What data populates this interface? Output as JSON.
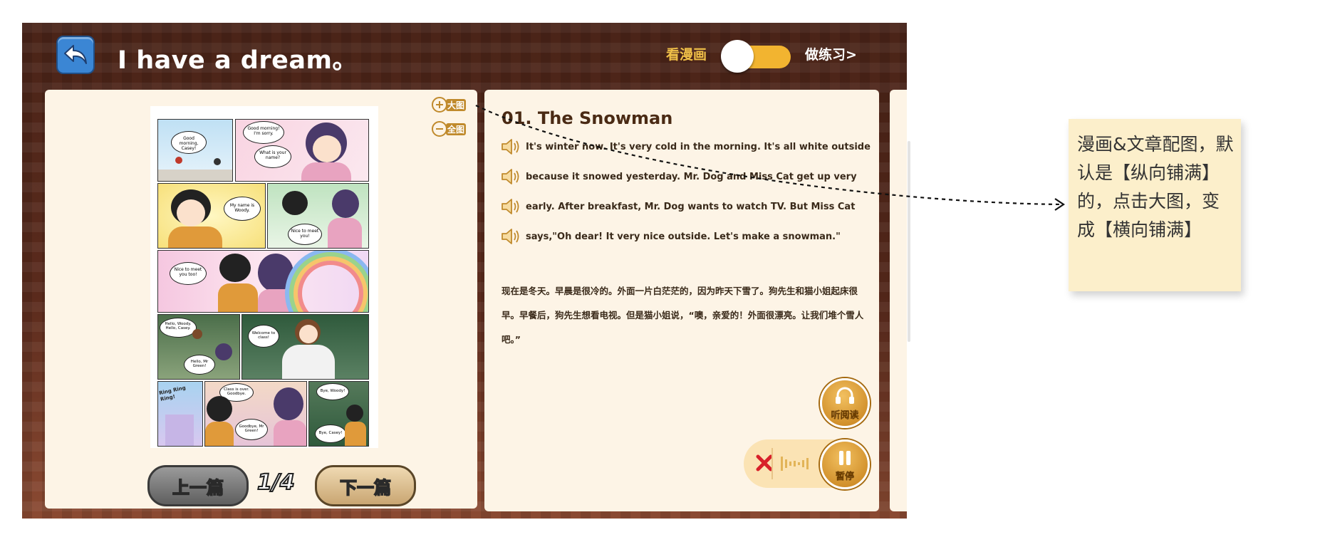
{
  "header": {
    "title": "I have a dream。",
    "mode_comic_label": "看漫画",
    "mode_exercise_label": "做练习>"
  },
  "left_panel": {
    "zoom_in_label": "大图",
    "zoom_out_label": "全图",
    "prev_label": "上一篇",
    "next_label": "下一篇",
    "page_indicator": "1/4",
    "comic_bubbles": {
      "b1": "Good morning, Casey!",
      "b2": "Good morning! I'm sorry.",
      "b3": "What is your name?",
      "b4": "My name is Woody.",
      "b5": "Nice to meet you!",
      "b6": "Nice to meet you too!",
      "b7": "Hello, Woody. Hello, Casey.",
      "b8": "Hello, Mr Green!",
      "b9": "Welcome to class!",
      "b10": "Ring Ring Ring!",
      "b11": "Class is over. Goodbye.",
      "b12": "Goodbye, Mr Green!",
      "b13": "Bye, Woody!",
      "b14": "Bye, Casey!"
    }
  },
  "article": {
    "title": "01. The Snowman",
    "english_lines": [
      "It's winter now. It's very cold in the morning. It's all white outside",
      "because it snowed yesterday. Mr. Dog and Miss Cat get up very",
      "early. After breakfast, Mr. Dog wants to watch TV. But Miss Cat",
      "says,\"Oh dear! It  very nice outside. Let's make a snowman.\""
    ],
    "chinese_text": "现在是冬天。早晨是很冷的。外面一片白茫茫的，因为昨天下雪了。狗先生和猫小姐起床很早。早餐后，狗先生想看电视。但是猫小姐说，“噢，亲爱的！外面很漂亮。让我们堆个雪人吧。”",
    "listen_label": "听阅读",
    "pause_label": "暂停"
  },
  "annotation": {
    "note_text": "漫画&文章配图，默认是【纵向铺满】的，点击大图，变成【横向铺满】"
  },
  "colors": {
    "accent_gold": "#f2b430",
    "back_button_blue": "#3b86d4",
    "background_brown": "#4a2418",
    "panel_cream": "#fdf4e6"
  }
}
